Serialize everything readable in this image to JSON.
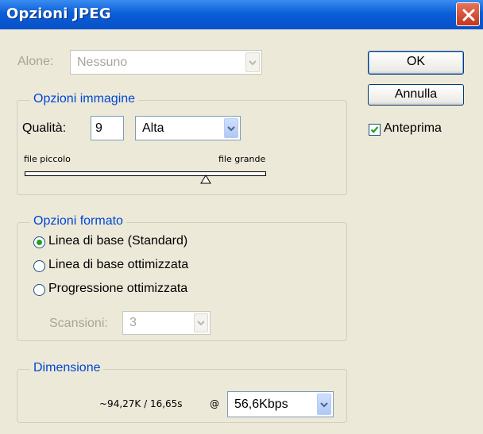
{
  "window": {
    "title": "Opzioni JPEG"
  },
  "matte": {
    "label": "Alone:",
    "value": "Nessuno"
  },
  "buttons": {
    "ok": "OK",
    "cancel": "Annulla"
  },
  "preview": {
    "label": "Anteprima",
    "checked": true
  },
  "image_options": {
    "title": "Opzioni immagine",
    "quality_label": "Qualità:",
    "quality_value": "9",
    "quality_preset": "Alta",
    "slider_min_label": "file piccolo",
    "slider_max_label": "file grande",
    "slider_value": 9,
    "slider_max": 12
  },
  "format_options": {
    "title": "Opzioni formato",
    "options": [
      "Linea di base (Standard)",
      "Linea di base ottimizzata",
      "Progressione ottimizzata"
    ],
    "selected_index": 0,
    "scans_label": "Scansioni:",
    "scans_value": "3"
  },
  "size": {
    "title": "Dimensione",
    "estimate": "~94,27K / 16,65s",
    "at": "@",
    "speed": "56,6Kbps"
  },
  "colors": {
    "group_title": "#0046d5",
    "radio_dot": "#21a121",
    "check": "#21a121"
  }
}
